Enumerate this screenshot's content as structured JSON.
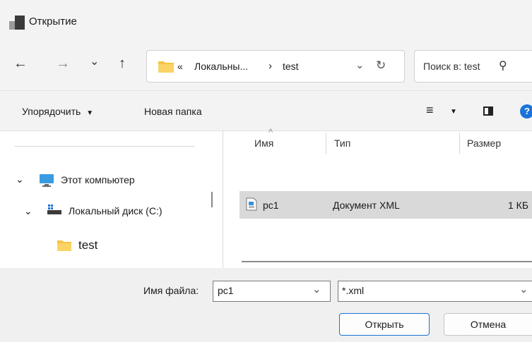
{
  "window": {
    "title": "Открытие"
  },
  "nav": {
    "back_icon": "←",
    "forward_icon": "→",
    "history_icon": "⌄",
    "up_icon": "↑",
    "address_prefix": "«",
    "address_folder": "Локальны...",
    "address_chevron": "›",
    "address_current": "test",
    "address_dropdown_icon": "⌄",
    "refresh_icon": "↻",
    "search_placeholder": "Поиск в: test",
    "search_icon": "⚲"
  },
  "toolbar": {
    "organize_label": "Упорядочить",
    "organize_arrow": "▼",
    "new_folder_label": "Новая папка",
    "view_icon": "≡",
    "view_arrow": "▼",
    "help_icon": "?"
  },
  "tree": {
    "items": [
      {
        "label": "Этот компьютер",
        "expander": "⌄",
        "icon": "computer-icon"
      },
      {
        "label": "Локальный диск (C:)",
        "expander": "⌄",
        "icon": "drive-icon"
      },
      {
        "label": "test",
        "icon": "folder-icon"
      }
    ]
  },
  "list": {
    "columns": [
      "Имя",
      "Тип",
      "Размер"
    ],
    "sort_indicator": "^",
    "rows": [
      {
        "name": "pc1",
        "type": "Документ XML",
        "size": "1 КБ"
      }
    ]
  },
  "bottom": {
    "filename_label": "Имя файла:",
    "filename_value": "pc1",
    "filter_value": "*.xml",
    "open_label": "Открыть",
    "cancel_label": "Отмена"
  },
  "colors": {
    "folder": "#f5c344",
    "selected_row": "#d9d9d9",
    "help_blue": "#1a73d9",
    "monitor": "#3a9ce0"
  }
}
